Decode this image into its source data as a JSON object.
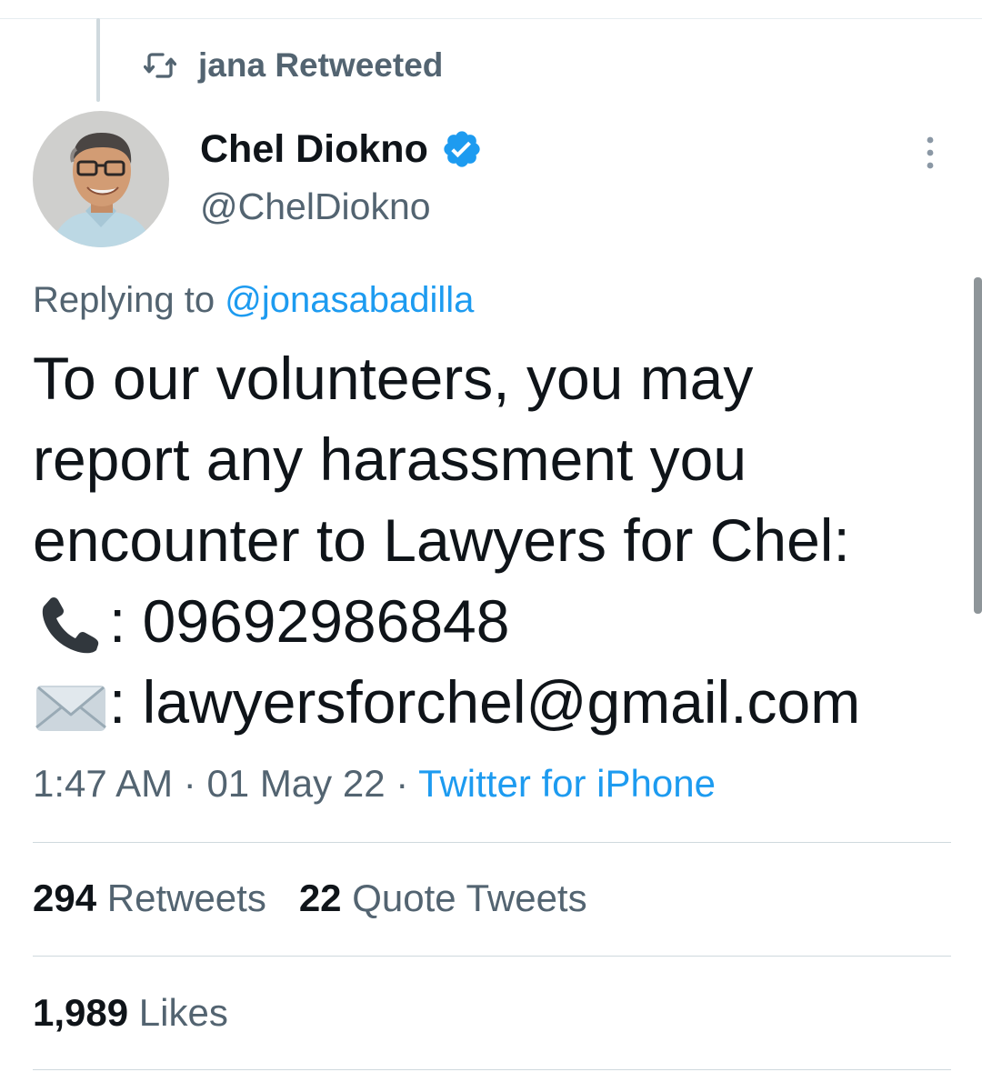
{
  "retweet_context": {
    "label": "jana Retweeted",
    "icon": "retweet-icon"
  },
  "author": {
    "display_name": "Chel Diokno",
    "handle": "@ChelDiokno",
    "verified": true,
    "verified_color": "#1d9bf0"
  },
  "reply": {
    "prefix": "Replying to",
    "mention": "@jonasabadilla"
  },
  "tweet": {
    "lines": [
      "To our volunteers, you may",
      "report any harassment you",
      "encounter to Lawyers for Chel:"
    ],
    "phone_icon": "telephone-receiver-emoji",
    "phone": ": 09692986848",
    "email_icon": "envelope-emoji",
    "email": ": lawyersforchel@gmail.com"
  },
  "meta": {
    "time": "1:47 AM",
    "separator": " · ",
    "date": "01 May 22",
    "source": "Twitter for iPhone"
  },
  "stats": {
    "retweets_count": "294",
    "retweets_label": "Retweets",
    "quotes_count": "22",
    "quotes_label": "Quote Tweets",
    "likes_count": "1,989",
    "likes_label": "Likes"
  },
  "colors": {
    "accent": "#1d9bf0",
    "secondary_text": "#536471",
    "primary_text": "#0f1419"
  }
}
